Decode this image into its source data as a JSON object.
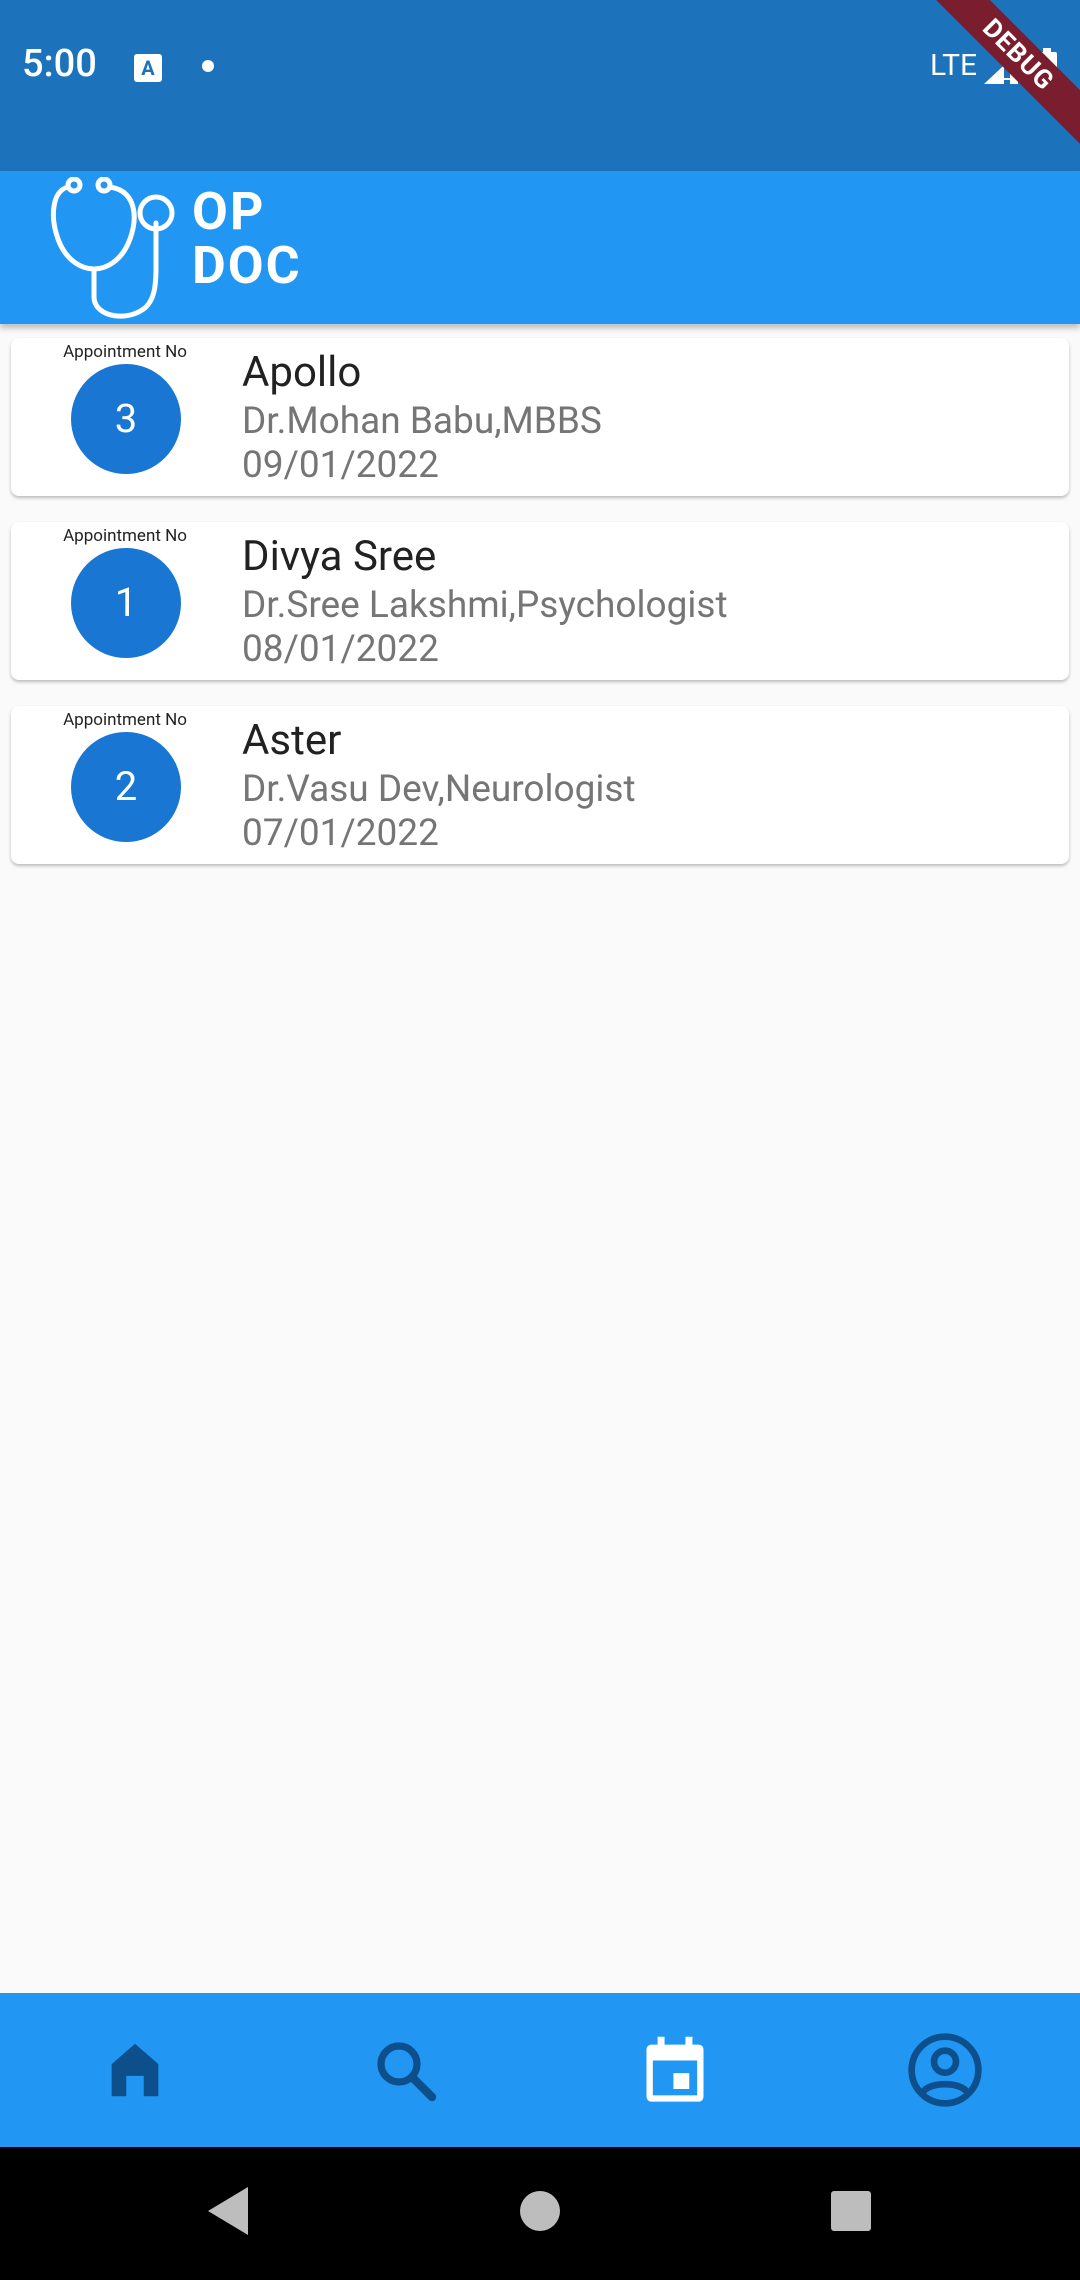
{
  "status_bar": {
    "time": "5:00",
    "network": "LTE",
    "icons": [
      "text-a-icon",
      "dot-icon",
      "signal-icon",
      "battery-icon"
    ]
  },
  "debug_banner": "DEBUG",
  "app": {
    "logo_line1": "OP",
    "logo_line2": "DOC",
    "logo_icon": "stethoscope-icon"
  },
  "appointments": [
    {
      "label": "Appointment No",
      "number": "3",
      "hospital": "Apollo",
      "doctor": "Dr.Mohan Babu,MBBS",
      "date": "09/01/2022"
    },
    {
      "label": "Appointment No",
      "number": "1",
      "hospital": "Divya Sree",
      "doctor": "Dr.Sree Lakshmi,Psychologist",
      "date": "08/01/2022"
    },
    {
      "label": "Appointment No",
      "number": "2",
      "hospital": "Aster",
      "doctor": "Dr.Vasu Dev,Neurologist",
      "date": "07/01/2022"
    }
  ],
  "bottom_nav": [
    {
      "icon": "home-icon",
      "selected": false
    },
    {
      "icon": "search-icon",
      "selected": false
    },
    {
      "icon": "calendar-icon",
      "selected": true
    },
    {
      "icon": "account-circle-icon",
      "selected": false
    }
  ],
  "system_nav": [
    "back-icon",
    "home-circle-icon",
    "recents-icon"
  ],
  "colors": {
    "status_bar": "#1c72bb",
    "app_bar": "#2196f3",
    "circle": "#1976d2",
    "nav_inactive": "#0d4f8a",
    "nav_active": "#ffffff"
  }
}
